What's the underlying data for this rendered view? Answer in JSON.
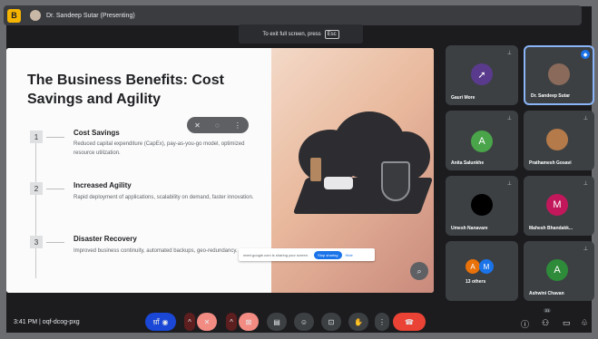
{
  "topbar": {
    "logo_letter": "B",
    "presenter_label": "Dr. Sandeep Sutar (Presenting)"
  },
  "fullscreen_hint": {
    "text": "To exit full screen, press",
    "key": "Esc"
  },
  "slide": {
    "title": "The Business Benefits: Cost Savings and Agility",
    "steps": [
      {
        "num": "1",
        "title": "Cost Savings",
        "desc": "Reduced capital expenditure (CapEx), pay-as-you-go model, optimized resource utilization."
      },
      {
        "num": "2",
        "title": "Increased Agility",
        "desc": "Rapid deployment of applications, scalability on demand, faster innovation."
      },
      {
        "num": "3",
        "title": "Disaster Recovery",
        "desc": "Improved business continuity, automated backups, geo-redundancy."
      }
    ]
  },
  "share_bar": {
    "text": "meet.google.com is sharing your screen.",
    "stop_label": "Stop sharing",
    "hide_label": "Hide"
  },
  "participants": [
    {
      "name": "Gauri More",
      "initial": "",
      "color": "#5a3a8c"
    },
    {
      "name": "Dr. Sandeep Sutar",
      "initial": "",
      "color": "#8a6a5a"
    },
    {
      "name": "Anita Salunkhe",
      "initial": "A",
      "color": "#4aa44a"
    },
    {
      "name": "Prathamesh Gosavi",
      "initial": "",
      "color": "#b47a4a"
    },
    {
      "name": "Umesh Nanavare",
      "initial": "",
      "color": "#000000"
    },
    {
      "name": "Mahesh Bhandakk...",
      "initial": "M",
      "color": "#c2185b"
    },
    {
      "name": "13 others",
      "initial": "",
      "color": ""
    },
    {
      "name": "Ashwini Chavan",
      "initial": "A",
      "color": "#2e8b3a"
    }
  ],
  "others_avatars": [
    {
      "initial": "A",
      "color": "#e8710a"
    },
    {
      "initial": "M",
      "color": "#1a73e8"
    }
  ],
  "bottom": {
    "time": "3:41 PM",
    "meeting_code": "oqf-dcog-pxg",
    "captions_label": "ध़ाँ",
    "participant_count": "21"
  },
  "colors": {
    "accent": "#8ab4f8",
    "end_call": "#ea4335",
    "muted": "#f28b82"
  }
}
